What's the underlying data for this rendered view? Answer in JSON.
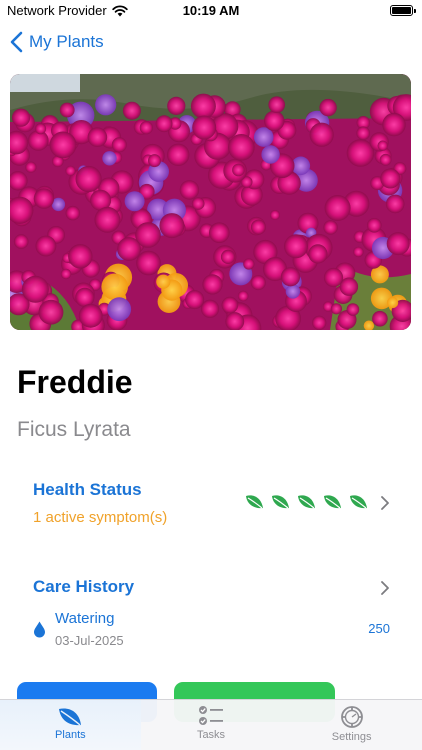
{
  "status_bar": {
    "carrier": "Network Provider",
    "time": "10:19 AM"
  },
  "nav": {
    "back_label": "My Plants"
  },
  "plant": {
    "name": "Freddie",
    "species": "Ficus Lyrata"
  },
  "health": {
    "title": "Health Status",
    "subtitle": "1 active symptom(s)",
    "leaf_count": 5,
    "leaf_color": "#2fa84f",
    "subtitle_color": "#f0a22a"
  },
  "care_history": {
    "title": "Care History",
    "entry": {
      "label": "Watering",
      "date": "03-Jul-2025",
      "amount": "250"
    }
  },
  "buttons": {
    "primary_color": "#1b7bf0",
    "secondary_color": "#34c759"
  },
  "tab_bar": {
    "tabs": [
      {
        "label": "Plants",
        "icon": "leaf-icon",
        "active": true
      },
      {
        "label": "Tasks",
        "icon": "checklist-icon",
        "active": false
      },
      {
        "label": "Settings",
        "icon": "gear-icon",
        "active": false
      }
    ]
  },
  "colors": {
    "accent": "#1b74d6",
    "secondary_text": "#8a8a8e"
  }
}
